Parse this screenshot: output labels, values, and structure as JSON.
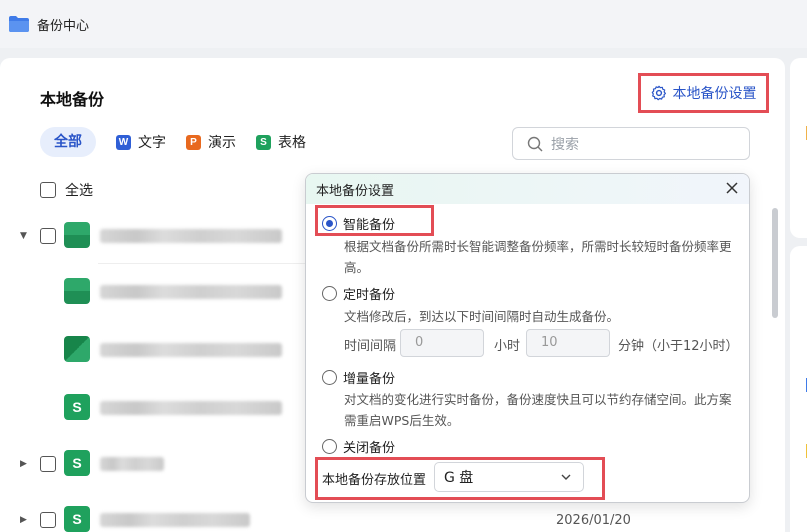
{
  "window": {
    "title": "备份中心"
  },
  "page": {
    "section_title": "本地备份",
    "settings_button": "本地备份设置",
    "filters": [
      {
        "label": "全部",
        "active": true
      },
      {
        "label": "文字",
        "icon_letter": "W",
        "color": "#2f5fd6"
      },
      {
        "label": "演示",
        "icon_letter": "P",
        "color": "#e8691f"
      },
      {
        "label": "表格",
        "icon_letter": "S",
        "color": "#1fa15d"
      }
    ],
    "search_placeholder": "搜索",
    "select_all_label": "全选",
    "rows": [
      {
        "type": "sheet",
        "expandable": true,
        "checkbox": true
      },
      {
        "type": "sheet",
        "expandable": false,
        "checkbox": false
      },
      {
        "type": "sheet",
        "expandable": false,
        "checkbox": false
      },
      {
        "type": "sheet-s",
        "expandable": false,
        "checkbox": false
      },
      {
        "type": "sheet-s",
        "expandable": true,
        "checkbox": true
      },
      {
        "type": "sheet-s",
        "expandable": true,
        "checkbox": true
      }
    ],
    "last_row_date": "2026/01/20"
  },
  "popup": {
    "title": "本地备份设置",
    "options": [
      {
        "label": "智能备份",
        "checked": true,
        "desc": "根据文档备份所需时长智能调整备份频率，所需时长较短时备份频率更高。"
      },
      {
        "label": "定时备份",
        "checked": false,
        "desc": "文档修改后，到达以下时间间隔时自动生成备份。"
      },
      {
        "label": "增量备份",
        "checked": false,
        "desc": "对文档的变化进行实时备份，备份速度快且可以节约存储空间。此方案需重启WPS后生效。"
      },
      {
        "label": "关闭备份",
        "checked": false
      }
    ],
    "interval": {
      "label": "时间间隔",
      "hours_value": "0",
      "hours_unit": "小时",
      "minutes_value": "10",
      "minutes_unit": "分钟（小于12小时）"
    },
    "location_label": "本地备份存放位置",
    "location_value": "G 盘"
  },
  "colors": {
    "accent": "#2a55c8",
    "highlight": "#e34d55"
  }
}
